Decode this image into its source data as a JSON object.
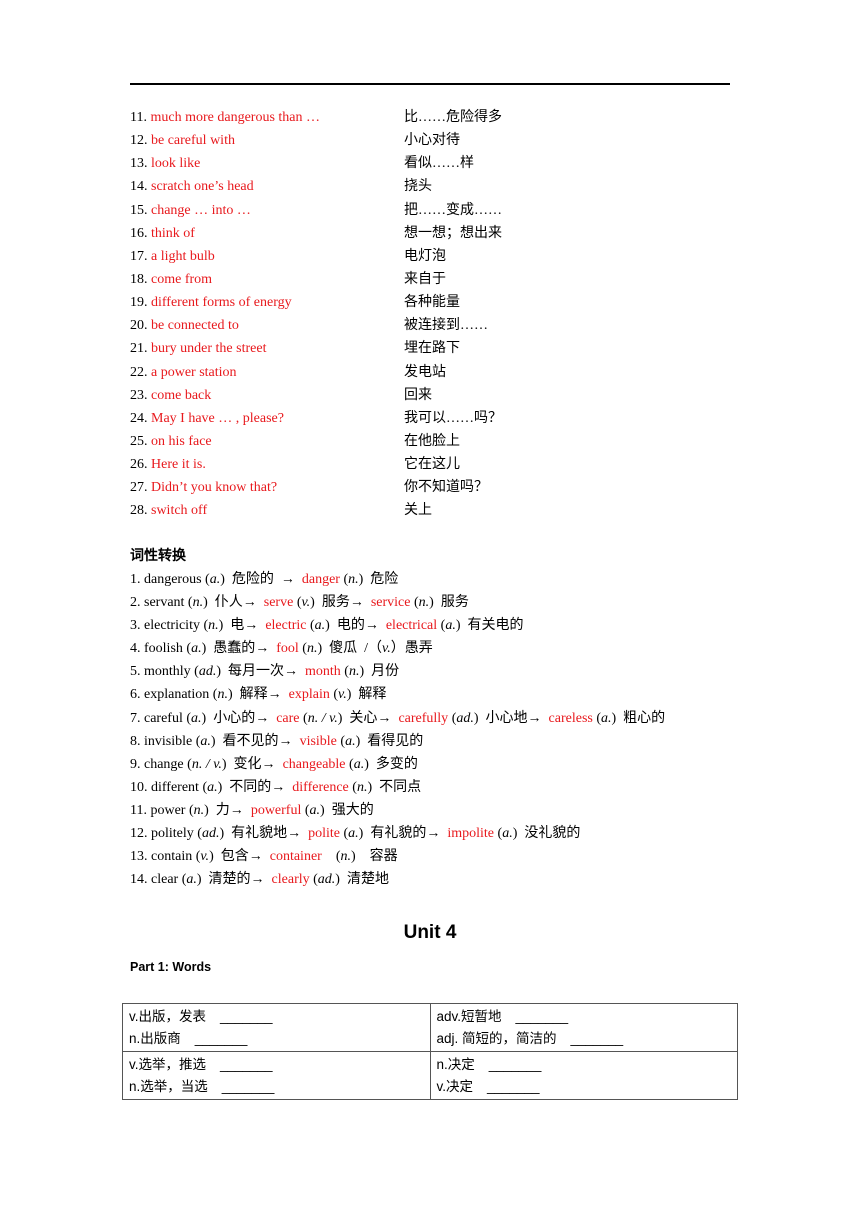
{
  "phrases": [
    {
      "num": "11.",
      "en": "much more dangerous than …",
      "cn": "比……危险得多"
    },
    {
      "num": "12.",
      "en": "be careful with",
      "cn": "小心对待"
    },
    {
      "num": "13.",
      "en": "look like",
      "cn": "看似……样"
    },
    {
      "num": "14.",
      "en": "scratch one’s head",
      "cn": "挠头"
    },
    {
      "num": "15.",
      "en": "change … into …",
      "cn": "把……变成……"
    },
    {
      "num": "16.",
      "en": "think of",
      "cn": "想一想；想出来"
    },
    {
      "num": "17.",
      "en": "a light bulb",
      "cn": "电灯泡"
    },
    {
      "num": "18.",
      "en": "come from",
      "cn": "来自于"
    },
    {
      "num": "19.",
      "en": "different forms of energy",
      "cn": "各种能量"
    },
    {
      "num": "20.",
      "en": "be connected to",
      "cn": "被连接到……"
    },
    {
      "num": "21.",
      "en": "bury under the street",
      "cn": "埋在路下"
    },
    {
      "num": "22.",
      "en": "a power station",
      "cn": "发电站"
    },
    {
      "num": "23.",
      "en": "come back",
      "cn": "回来"
    },
    {
      "num": "24.",
      "en": "May I have … , please?",
      "cn": "我可以……吗？"
    },
    {
      "num": "25.",
      "en": "on his face",
      "cn": "在他脸上"
    },
    {
      "num": "26.",
      "en": "Here it is.",
      "cn": "它在这儿"
    },
    {
      "num": "27.",
      "en": "Didn’t you know that?",
      "cn": "你不知道吗？"
    },
    {
      "num": "28.",
      "en": "switch off",
      "cn": "关上"
    }
  ],
  "conversion": {
    "title": "词性转换",
    "items": [
      {
        "segments": [
          {
            "t": "1. dangerous (",
            "c": "k"
          },
          {
            "t": "a.",
            "c": "i"
          },
          {
            "t": ")  危险的  →  ",
            "c": "k"
          },
          {
            "t": "danger",
            "c": "r"
          },
          {
            "t": " (",
            "c": "k"
          },
          {
            "t": "n.",
            "c": "i"
          },
          {
            "t": ")  危险",
            "c": "k"
          }
        ]
      },
      {
        "segments": [
          {
            "t": "2. servant (",
            "c": "k"
          },
          {
            "t": "n.",
            "c": "i"
          },
          {
            "t": ")  仆人→  ",
            "c": "k"
          },
          {
            "t": "serve",
            "c": "r"
          },
          {
            "t": " (",
            "c": "k"
          },
          {
            "t": "v.",
            "c": "i"
          },
          {
            "t": ")  服务→  ",
            "c": "k"
          },
          {
            "t": "service",
            "c": "r"
          },
          {
            "t": " (",
            "c": "k"
          },
          {
            "t": "n.",
            "c": "i"
          },
          {
            "t": ")  服务",
            "c": "k"
          }
        ]
      },
      {
        "segments": [
          {
            "t": "3. electricity (",
            "c": "k"
          },
          {
            "t": "n.",
            "c": "i"
          },
          {
            "t": ")  电→  ",
            "c": "k"
          },
          {
            "t": "electric",
            "c": "r"
          },
          {
            "t": " (",
            "c": "k"
          },
          {
            "t": "a.",
            "c": "i"
          },
          {
            "t": ")  电的→  ",
            "c": "k"
          },
          {
            "t": "electrical",
            "c": "r"
          },
          {
            "t": " (",
            "c": "k"
          },
          {
            "t": "a.",
            "c": "i"
          },
          {
            "t": ")  有关电的",
            "c": "k"
          }
        ]
      },
      {
        "segments": [
          {
            "t": "4. foolish (",
            "c": "k"
          },
          {
            "t": "a.",
            "c": "i"
          },
          {
            "t": ")  愚蠢的→  ",
            "c": "k"
          },
          {
            "t": "fool",
            "c": "r"
          },
          {
            "t": " (",
            "c": "k"
          },
          {
            "t": "n.",
            "c": "i"
          },
          {
            "t": ")  傻瓜  /（",
            "c": "k"
          },
          {
            "t": "v.",
            "c": "i"
          },
          {
            "t": "）愚弄",
            "c": "k"
          }
        ]
      },
      {
        "segments": [
          {
            "t": "5. monthly (",
            "c": "k"
          },
          {
            "t": "ad.",
            "c": "i"
          },
          {
            "t": ")  每月一次→  ",
            "c": "k"
          },
          {
            "t": "month",
            "c": "r"
          },
          {
            "t": " (",
            "c": "k"
          },
          {
            "t": "n.",
            "c": "i"
          },
          {
            "t": ")  月份",
            "c": "k"
          }
        ]
      },
      {
        "segments": [
          {
            "t": "6. explanation (",
            "c": "k"
          },
          {
            "t": "n.",
            "c": "i"
          },
          {
            "t": ")  解释→  ",
            "c": "k"
          },
          {
            "t": "explain",
            "c": "r"
          },
          {
            "t": " (",
            "c": "k"
          },
          {
            "t": "v.",
            "c": "i"
          },
          {
            "t": ")  解释",
            "c": "k"
          }
        ]
      },
      {
        "segments": [
          {
            "t": "7. careful (",
            "c": "k"
          },
          {
            "t": "a.",
            "c": "i"
          },
          {
            "t": ")  小心的→  ",
            "c": "k"
          },
          {
            "t": "care",
            "c": "r"
          },
          {
            "t": " (",
            "c": "k"
          },
          {
            "t": "n. / v.",
            "c": "i"
          },
          {
            "t": ")  关心→  ",
            "c": "k"
          },
          {
            "t": "carefully",
            "c": "r"
          },
          {
            "t": " (",
            "c": "k"
          },
          {
            "t": "ad.",
            "c": "i"
          },
          {
            "t": ")  小心地→  ",
            "c": "k"
          },
          {
            "t": "careless",
            "c": "r"
          },
          {
            "t": " (",
            "c": "k"
          },
          {
            "t": "a.",
            "c": "i"
          },
          {
            "t": ")  粗心的",
            "c": "k"
          }
        ]
      },
      {
        "segments": [
          {
            "t": "8. invisible (",
            "c": "k"
          },
          {
            "t": "a.",
            "c": "i"
          },
          {
            "t": ")  看不见的→  ",
            "c": "k"
          },
          {
            "t": "visible",
            "c": "r"
          },
          {
            "t": " (",
            "c": "k"
          },
          {
            "t": "a.",
            "c": "i"
          },
          {
            "t": ")  看得见的",
            "c": "k"
          }
        ]
      },
      {
        "segments": [
          {
            "t": "9. change (",
            "c": "k"
          },
          {
            "t": "n. / v.",
            "c": "i"
          },
          {
            "t": ")  变化→  ",
            "c": "k"
          },
          {
            "t": "changeable",
            "c": "r"
          },
          {
            "t": " (",
            "c": "k"
          },
          {
            "t": "a.",
            "c": "i"
          },
          {
            "t": ")  多变的",
            "c": "k"
          }
        ]
      },
      {
        "segments": [
          {
            "t": "10. different (",
            "c": "k"
          },
          {
            "t": "a.",
            "c": "i"
          },
          {
            "t": ")  不同的→  ",
            "c": "k"
          },
          {
            "t": "difference",
            "c": "r"
          },
          {
            "t": " (",
            "c": "k"
          },
          {
            "t": "n.",
            "c": "i"
          },
          {
            "t": ")  不同点",
            "c": "k"
          }
        ]
      },
      {
        "segments": [
          {
            "t": "11. power (",
            "c": "k"
          },
          {
            "t": "n.",
            "c": "i"
          },
          {
            "t": ")  力→  ",
            "c": "k"
          },
          {
            "t": "powerful",
            "c": "r"
          },
          {
            "t": " (",
            "c": "k"
          },
          {
            "t": "a.",
            "c": "i"
          },
          {
            "t": ")  强大的",
            "c": "k"
          }
        ]
      },
      {
        "segments": [
          {
            "t": "12. politely (",
            "c": "k"
          },
          {
            "t": "ad.",
            "c": "i"
          },
          {
            "t": ")  有礼貌地→  ",
            "c": "k"
          },
          {
            "t": "polite",
            "c": "r"
          },
          {
            "t": " (",
            "c": "k"
          },
          {
            "t": "a.",
            "c": "i"
          },
          {
            "t": ")  有礼貌的→  ",
            "c": "k"
          },
          {
            "t": "impolite",
            "c": "r"
          },
          {
            "t": " (",
            "c": "k"
          },
          {
            "t": "a.",
            "c": "i"
          },
          {
            "t": ")  没礼貌的",
            "c": "k"
          }
        ]
      },
      {
        "segments": [
          {
            "t": "13. contain (",
            "c": "k"
          },
          {
            "t": "v.",
            "c": "i"
          },
          {
            "t": ")  包含→  ",
            "c": "k"
          },
          {
            "t": "container",
            "c": "r"
          },
          {
            "t": "    (",
            "c": "k"
          },
          {
            "t": "n.",
            "c": "i"
          },
          {
            "t": ")    容器",
            "c": "k"
          }
        ]
      },
      {
        "segments": [
          {
            "t": "14. clear (",
            "c": "k"
          },
          {
            "t": "a.",
            "c": "i"
          },
          {
            "t": ")  清楚的→  ",
            "c": "k"
          },
          {
            "t": "clearly",
            "c": "r"
          },
          {
            "t": " (",
            "c": "k"
          },
          {
            "t": "ad.",
            "c": "i"
          },
          {
            "t": ")  清楚地",
            "c": "k"
          }
        ]
      }
    ]
  },
  "unit": {
    "title": "Unit 4",
    "part_title": "Part 1: Words",
    "table": [
      [
        [
          {
            "label": "v.出版，发表",
            "blank": "_______"
          },
          {
            "label": "n.出版商",
            "blank": "_______"
          }
        ],
        [
          {
            "label": "adv.短暂地",
            "blank": "_______"
          },
          {
            "label": "adj. 简短的，简洁的",
            "blank": "_______"
          }
        ]
      ],
      [
        [
          {
            "label": "v.选举，推选",
            "blank": "_______"
          },
          {
            "label": "n.选举，当选",
            "blank": "_______"
          }
        ],
        [
          {
            "label": "n.决定",
            "blank": "_______"
          },
          {
            "label": "v.决定",
            "blank": "_______"
          }
        ]
      ]
    ]
  },
  "colors": {
    "highlight": "#e8191d",
    "text": "#000000"
  }
}
